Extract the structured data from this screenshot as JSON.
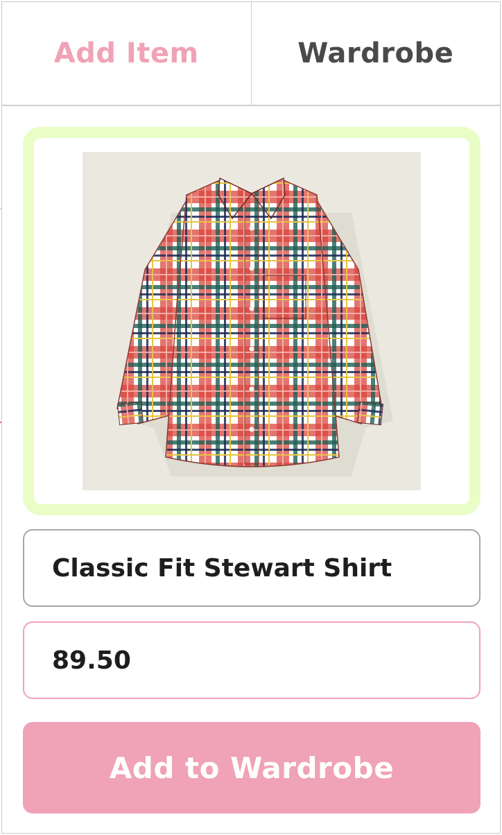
{
  "tabs": {
    "add_item": "Add Item",
    "wardrobe": "Wardrobe"
  },
  "item": {
    "name": "Classic Fit Stewart Shirt",
    "price": "89.50"
  },
  "actions": {
    "add_to_wardrobe": "Add to Wardrobe"
  },
  "colors": {
    "accent_pink": "#f0a2b6",
    "frame_green": "#e9fdc6",
    "tab_inactive": "#4a4a4a"
  }
}
